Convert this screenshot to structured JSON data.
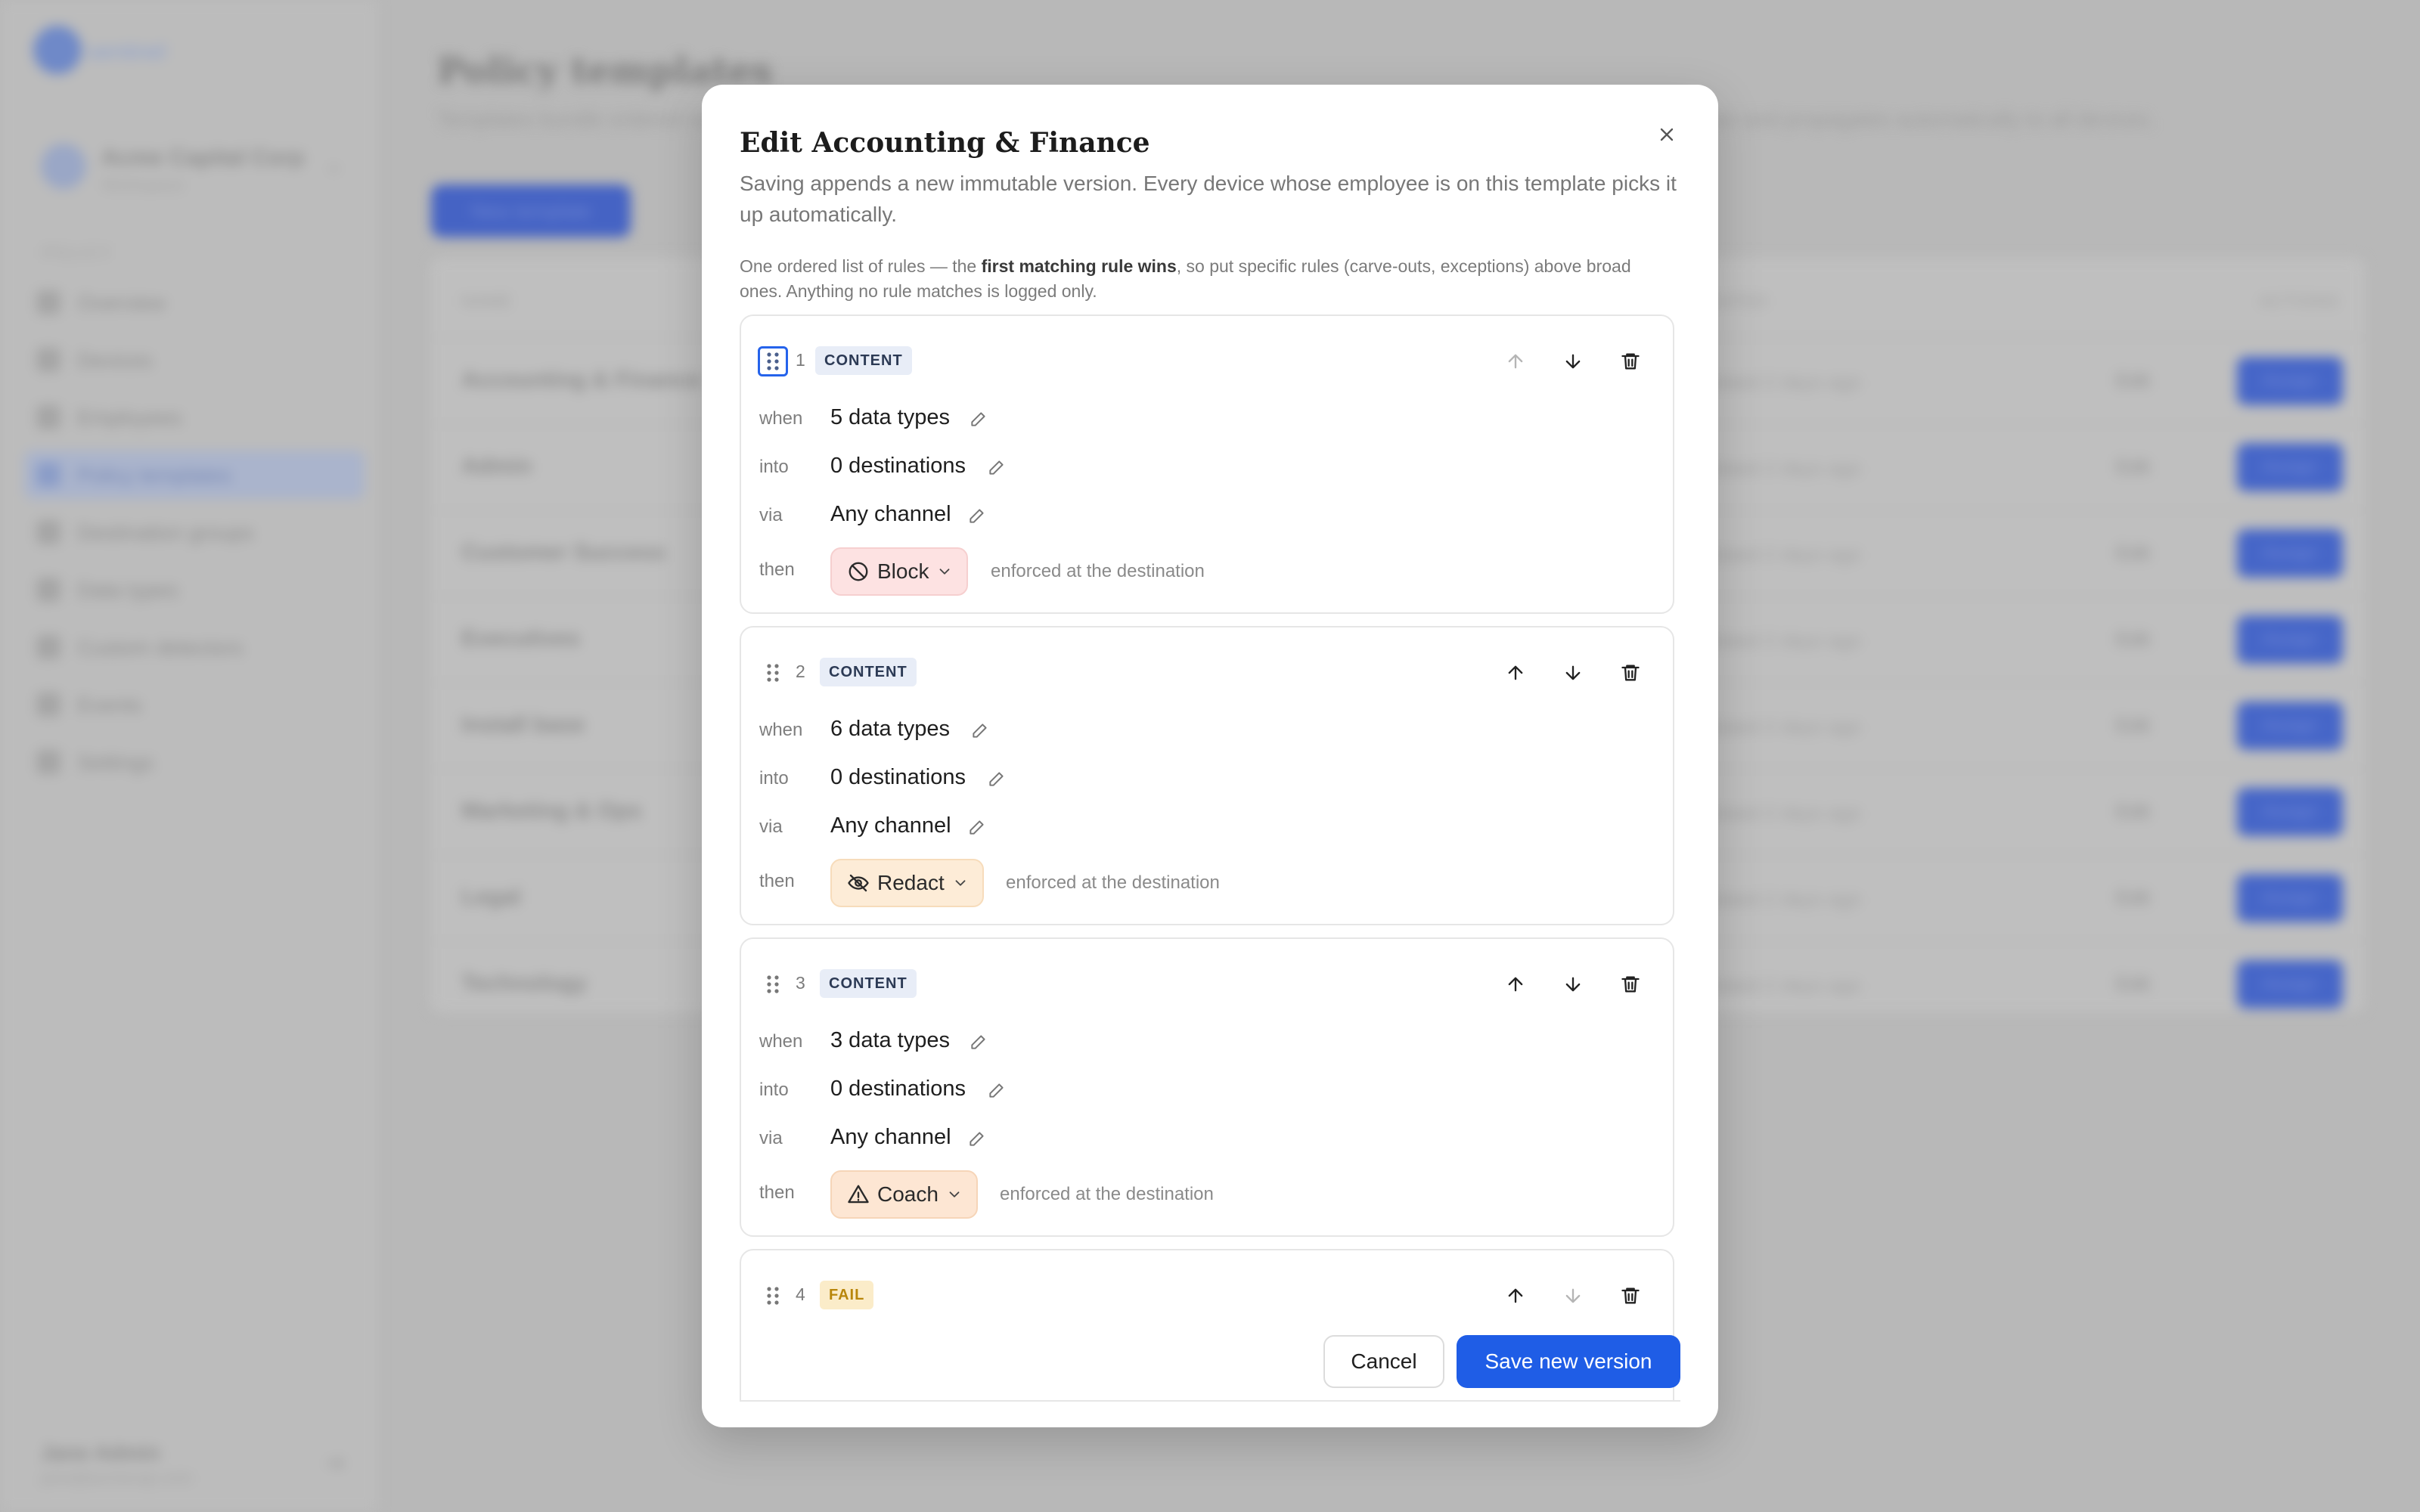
{
  "background": {
    "logo_text": "sentinel",
    "workspace": {
      "name": "Acme Capital Corp",
      "sub": "Workspace"
    },
    "nav_heading": "POLICY",
    "nav": [
      {
        "label": "Overview",
        "active": false
      },
      {
        "label": "Devices",
        "active": false
      },
      {
        "label": "Employees",
        "active": false
      },
      {
        "label": "Policy templates",
        "active": true
      },
      {
        "label": "Destination groups",
        "active": false
      },
      {
        "label": "Data types",
        "active": false
      },
      {
        "label": "Custom detectors",
        "active": false
      },
      {
        "label": "Events",
        "active": false
      },
      {
        "label": "Settings",
        "active": false
      }
    ],
    "user": {
      "name": "Jane Admin",
      "email": "jane@acmecap.com"
    },
    "page_title": "Policy templates",
    "page_desc": "Templates bundle ordered rules that apply to every device whose employee is assigned to them. Editing a template appends a new version and propagates automatically to all devices.",
    "new_button": "New template",
    "table": {
      "headers": {
        "name": "NAME",
        "updated": "UPDATED",
        "actions": "ACTIONS"
      },
      "rows": [
        {
          "name": "Accounting & Finance",
          "date": "Updated 2 days ago",
          "edit": "Edit",
          "assign": "Assign"
        },
        {
          "name": "Admin",
          "date": "Updated 2 days ago",
          "edit": "Edit",
          "assign": "Assign"
        },
        {
          "name": "Customer Success",
          "date": "Updated 2 days ago",
          "edit": "Edit",
          "assign": "Assign"
        },
        {
          "name": "Executives",
          "date": "Updated 2 days ago",
          "edit": "Edit",
          "assign": "Assign"
        },
        {
          "name": "Install base",
          "date": "Updated 2 days ago",
          "edit": "Edit",
          "assign": "Assign"
        },
        {
          "name": "Marketing & Ops",
          "date": "Updated 2 days ago",
          "edit": "Edit",
          "assign": "Assign"
        },
        {
          "name": "Legal",
          "date": "Updated 2 days ago",
          "edit": "Edit",
          "assign": "Assign"
        },
        {
          "name": "Technology",
          "date": "Updated 2 days ago",
          "edit": "Edit",
          "assign": "Assign"
        }
      ]
    }
  },
  "modal": {
    "title": "Edit Accounting & Finance",
    "subtitle": "Saving appends a new immutable version. Every device whose employee is on this template picks it up automatically.",
    "note_prefix": "One ordered list of rules — the ",
    "note_bold": "first matching rule wins",
    "note_suffix": ", so put specific rules (carve-outs, exceptions) above broad ones. Anything no rule matches is logged only.",
    "labels": {
      "when": "when",
      "into": "into",
      "via": "via",
      "then": "then",
      "enforced": "enforced at the destination"
    },
    "rules": [
      {
        "number": "1",
        "type": "CONTENT",
        "when": "5 data types",
        "into": "0 destinations",
        "via": "Any channel",
        "action": "Block"
      },
      {
        "number": "2",
        "type": "CONTENT",
        "when": "6 data types",
        "into": "0 destinations",
        "via": "Any channel",
        "action": "Redact"
      },
      {
        "number": "3",
        "type": "CONTENT",
        "when": "3 data types",
        "into": "0 destinations",
        "via": "Any channel",
        "action": "Coach"
      },
      {
        "number": "4",
        "type": "FAIL"
      }
    ],
    "cancel_label": "Cancel",
    "save_label": "Save new version"
  },
  "colors": {
    "primary": "#1f5de6",
    "block_bg": "#fde2e2",
    "redact_bg": "#fdecd7",
    "coach_bg": "#fde6d3",
    "badge_bg": "#e8edf7"
  }
}
